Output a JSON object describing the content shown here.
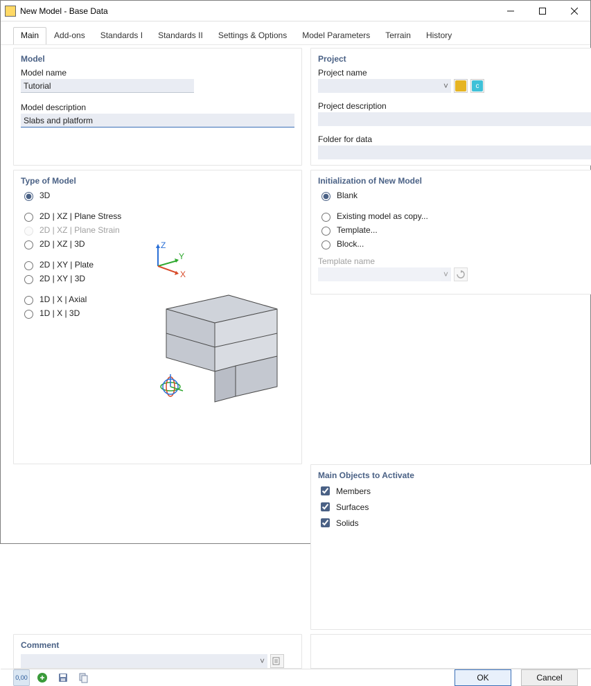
{
  "window": {
    "title": "New Model - Base Data"
  },
  "tabs": [
    "Main",
    "Add-ons",
    "Standards I",
    "Standards II",
    "Settings & Options",
    "Model Parameters",
    "Terrain",
    "History"
  ],
  "active_tab_index": 0,
  "model": {
    "heading": "Model",
    "name_label": "Model name",
    "name_value": "Tutorial",
    "desc_label": "Model description",
    "desc_value": "Slabs and platform"
  },
  "project": {
    "heading": "Project",
    "name_label": "Project name",
    "name_value": "",
    "desc_label": "Project description",
    "desc_value": "",
    "folder_label": "Folder for data",
    "folder_value": ""
  },
  "type_of_model": {
    "heading": "Type of Model",
    "options": [
      {
        "label": "3D",
        "checked": true,
        "disabled": false,
        "gap_after": true
      },
      {
        "label": "2D | XZ | Plane Stress",
        "checked": false,
        "disabled": false
      },
      {
        "label": "2D | XZ | Plane Strain",
        "checked": false,
        "disabled": true
      },
      {
        "label": "2D | XZ | 3D",
        "checked": false,
        "disabled": false,
        "gap_after": true
      },
      {
        "label": "2D | XY | Plate",
        "checked": false,
        "disabled": false
      },
      {
        "label": "2D | XY | 3D",
        "checked": false,
        "disabled": false,
        "gap_after": true
      },
      {
        "label": "1D | X | Axial",
        "checked": false,
        "disabled": false
      },
      {
        "label": "1D | X | 3D",
        "checked": false,
        "disabled": false
      }
    ],
    "axes": {
      "x": "X",
      "y": "Y",
      "z": "Z"
    }
  },
  "init": {
    "heading": "Initialization of New Model",
    "options": [
      {
        "label": "Blank",
        "checked": true,
        "gap_after": true
      },
      {
        "label": "Existing model as copy...",
        "checked": false
      },
      {
        "label": "Template...",
        "checked": false
      },
      {
        "label": "Block...",
        "checked": false
      }
    ],
    "template_label": "Template name",
    "template_value": ""
  },
  "main_objects": {
    "heading": "Main Objects to Activate",
    "items": [
      {
        "label": "Members",
        "checked": true
      },
      {
        "label": "Surfaces",
        "checked": true
      },
      {
        "label": "Solids",
        "checked": true
      }
    ]
  },
  "comment": {
    "heading": "Comment",
    "value": ""
  },
  "footer": {
    "icons": [
      "units-icon",
      "calc-icon",
      "save-icon",
      "copy-icon"
    ],
    "ok": "OK",
    "cancel": "Cancel"
  },
  "chevron": "˅",
  "icon_label_units": "0,00"
}
